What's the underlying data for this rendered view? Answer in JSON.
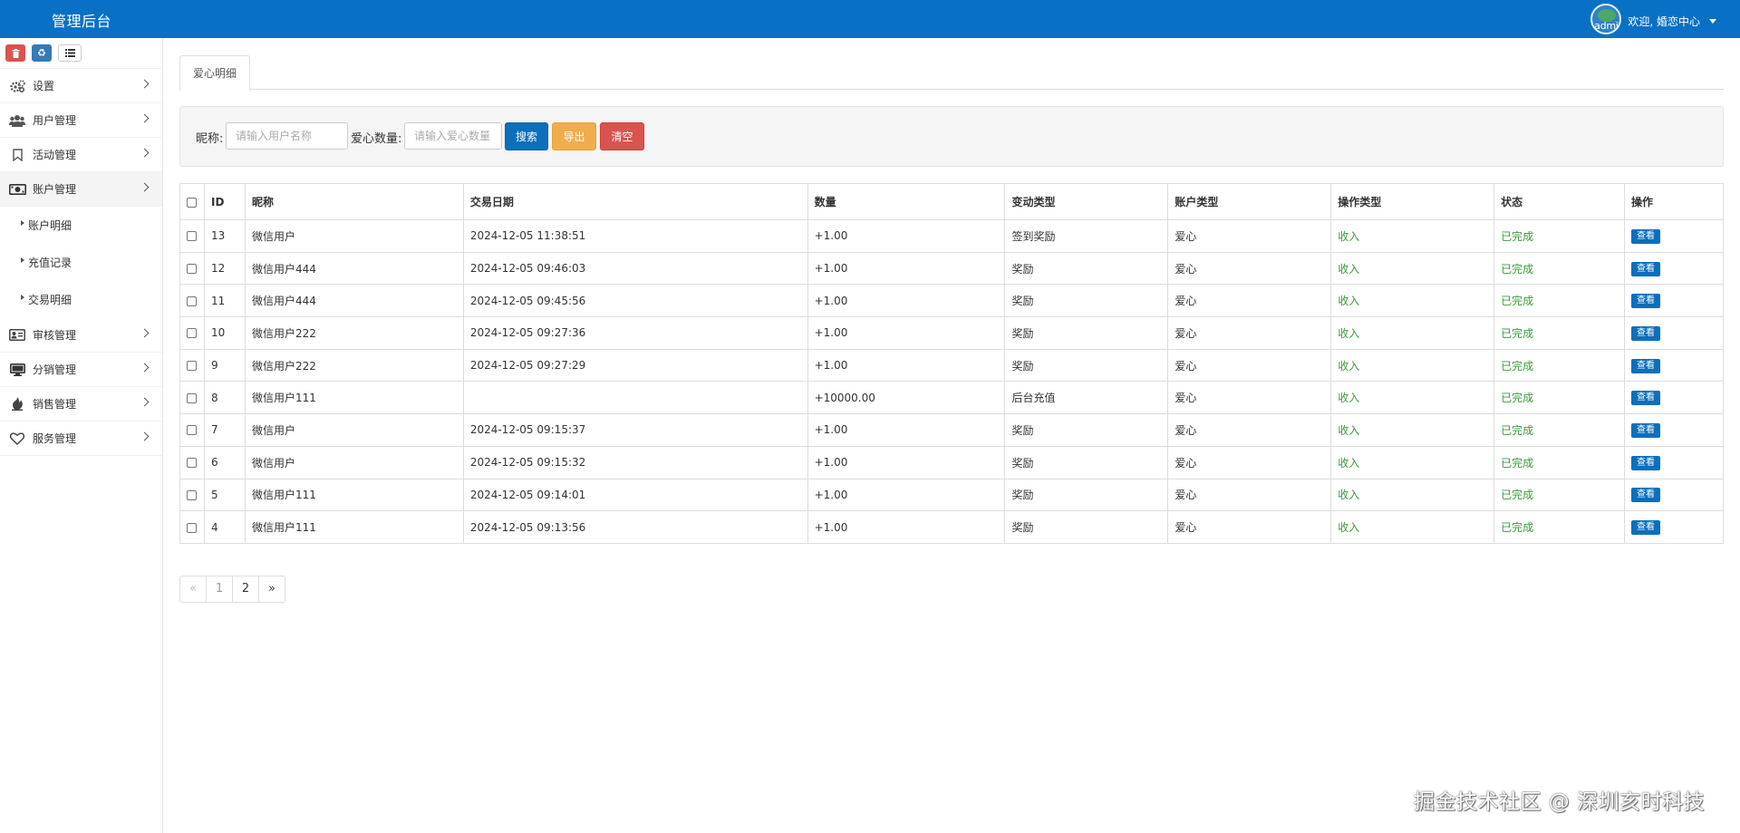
{
  "header": {
    "brand": "管理后台",
    "avatar_text": "admi",
    "welcome": "欢迎, 婚恋中心"
  },
  "sidebar": {
    "tools": [
      {
        "icon": "trash-icon",
        "color": "#d9534f"
      },
      {
        "icon": "recycle-icon",
        "color": "#337ab7"
      },
      {
        "icon": "list-icon",
        "color": "#ffffff"
      }
    ],
    "items": [
      {
        "label": "设置",
        "icon": "cogs-icon"
      },
      {
        "label": "用户管理",
        "icon": "users-icon"
      },
      {
        "label": "活动管理",
        "icon": "bookmark-icon"
      },
      {
        "label": "账户管理",
        "icon": "money-icon",
        "active": true,
        "children": [
          {
            "label": "账户明细"
          },
          {
            "label": "充值记录"
          },
          {
            "label": "交易明细"
          }
        ]
      },
      {
        "label": "审核管理",
        "icon": "id-card-icon"
      },
      {
        "label": "分销管理",
        "icon": "monitor-icon"
      },
      {
        "label": "销售管理",
        "icon": "fire-icon"
      },
      {
        "label": "服务管理",
        "icon": "heart-icon"
      }
    ]
  },
  "tab": {
    "label": "爱心明细"
  },
  "search": {
    "nickname_label": "昵称:",
    "nickname_placeholder": "请输入用户名称",
    "quantity_label": "爱心数量:",
    "quantity_placeholder": "请输入爱心数量",
    "search_button": "搜索",
    "export_button": "导出",
    "clear_button": "清空"
  },
  "table": {
    "columns": [
      "ID",
      "昵称",
      "交易日期",
      "数量",
      "变动类型",
      "账户类型",
      "操作类型",
      "状态",
      "操作"
    ],
    "action_label": "查看",
    "rows": [
      {
        "id": "13",
        "nickname": "微信用户",
        "date": "2024-12-05 11:38:51",
        "amount": "+1.00",
        "change_type": "签到奖励",
        "account_type": "爱心",
        "op_type": "收入",
        "status": "已完成"
      },
      {
        "id": "12",
        "nickname": "微信用户444",
        "date": "2024-12-05 09:46:03",
        "amount": "+1.00",
        "change_type": "奖励",
        "account_type": "爱心",
        "op_type": "收入",
        "status": "已完成"
      },
      {
        "id": "11",
        "nickname": "微信用户444",
        "date": "2024-12-05 09:45:56",
        "amount": "+1.00",
        "change_type": "奖励",
        "account_type": "爱心",
        "op_type": "收入",
        "status": "已完成"
      },
      {
        "id": "10",
        "nickname": "微信用户222",
        "date": "2024-12-05 09:27:36",
        "amount": "+1.00",
        "change_type": "奖励",
        "account_type": "爱心",
        "op_type": "收入",
        "status": "已完成"
      },
      {
        "id": "9",
        "nickname": "微信用户222",
        "date": "2024-12-05 09:27:29",
        "amount": "+1.00",
        "change_type": "奖励",
        "account_type": "爱心",
        "op_type": "收入",
        "status": "已完成"
      },
      {
        "id": "8",
        "nickname": "微信用户111",
        "date": "",
        "amount": "+10000.00",
        "change_type": "后台充值",
        "account_type": "爱心",
        "op_type": "收入",
        "status": "已完成"
      },
      {
        "id": "7",
        "nickname": "微信用户",
        "date": "2024-12-05 09:15:37",
        "amount": "+1.00",
        "change_type": "奖励",
        "account_type": "爱心",
        "op_type": "收入",
        "status": "已完成"
      },
      {
        "id": "6",
        "nickname": "微信用户",
        "date": "2024-12-05 09:15:32",
        "amount": "+1.00",
        "change_type": "奖励",
        "account_type": "爱心",
        "op_type": "收入",
        "status": "已完成"
      },
      {
        "id": "5",
        "nickname": "微信用户111",
        "date": "2024-12-05 09:14:01",
        "amount": "+1.00",
        "change_type": "奖励",
        "account_type": "爱心",
        "op_type": "收入",
        "status": "已完成"
      },
      {
        "id": "4",
        "nickname": "微信用户111",
        "date": "2024-12-05 09:13:56",
        "amount": "+1.00",
        "change_type": "奖励",
        "account_type": "爱心",
        "op_type": "收入",
        "status": "已完成"
      }
    ]
  },
  "pagination": {
    "prev": "«",
    "pages": [
      "1",
      "2"
    ],
    "current": "1",
    "next": "»"
  },
  "watermark": "掘金技术社区 @ 深圳亥时科技",
  "colors": {
    "header_bg": "#0871c5",
    "primary": "#0b6fbc",
    "warning": "#efad4d",
    "danger": "#d9534f",
    "success_text": "#3c9a3c"
  }
}
